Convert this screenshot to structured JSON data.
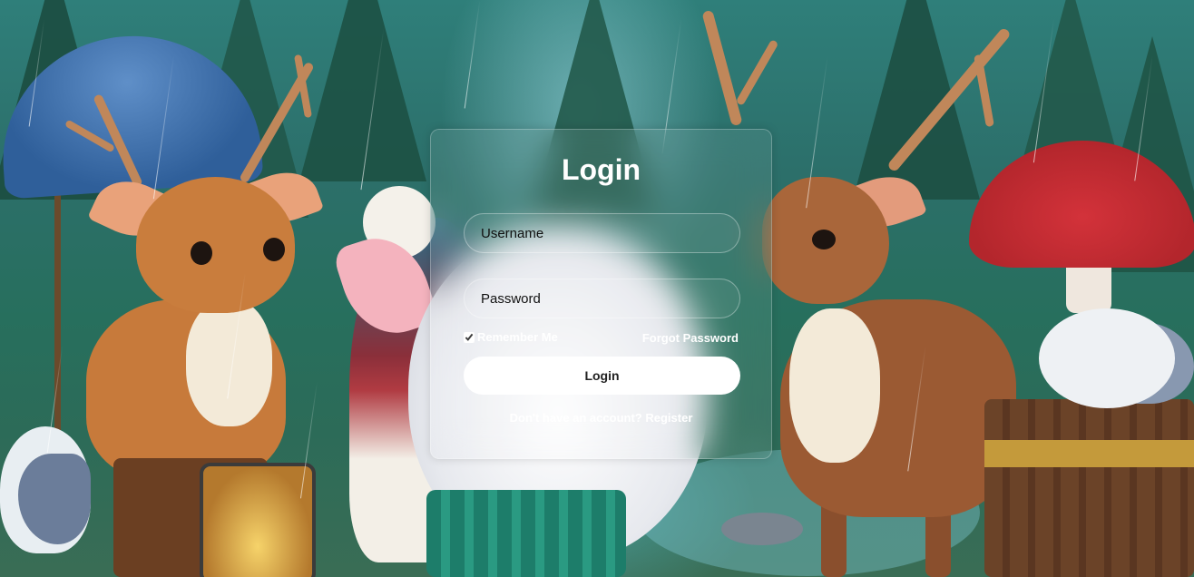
{
  "login_card": {
    "title": "Login",
    "username_placeholder": "Username",
    "password_placeholder": "Password",
    "remember_label": "Remember Me",
    "remember_checked": true,
    "forgot_label": "Forgot Password",
    "submit_label": "Login",
    "register_prompt": "Don't have an account?",
    "register_link": "Register"
  },
  "background": {
    "description_icon": "rainy-forest-illustration"
  }
}
